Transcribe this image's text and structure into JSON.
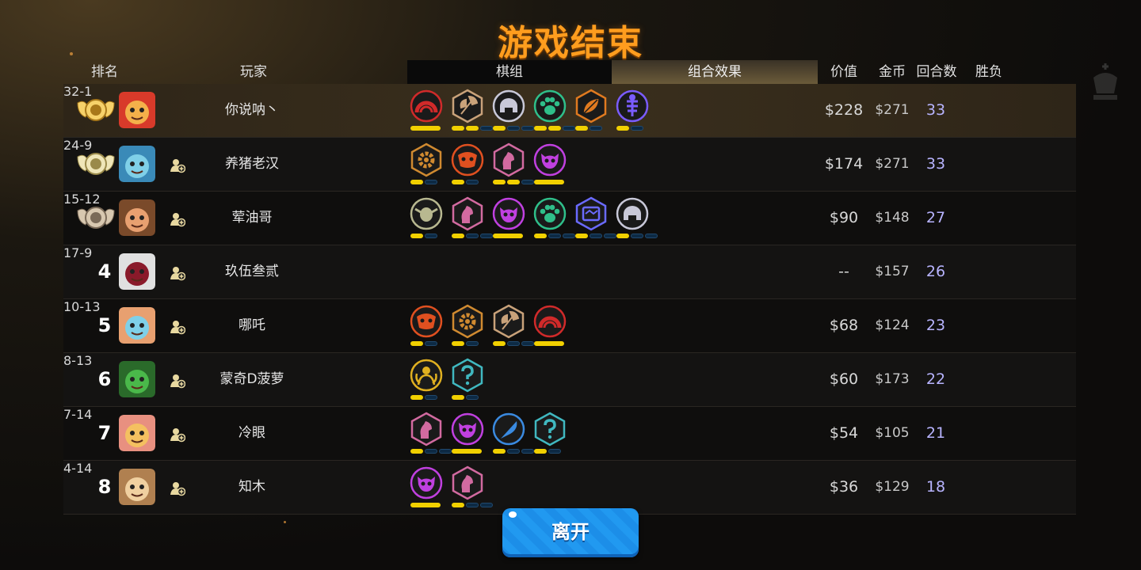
{
  "title": "游戏结束",
  "headers": {
    "rank": "排名",
    "player": "玩家",
    "pieces": "棋组",
    "combo": "组合效果",
    "value": "价值",
    "gold": "金币",
    "rounds": "回合数",
    "winloss": "胜负"
  },
  "leave_button": "离开",
  "colors": {
    "title": "#ff9d1e",
    "bar_on": "#f1d000",
    "bar_off": "#0d2a44",
    "rounds": "#b8b4ff",
    "button": "#1c8ee8"
  },
  "players": [
    {
      "rank": "1",
      "medal": "gold-medal",
      "name": "你说呐丶",
      "value": "$228",
      "gold": "$271",
      "rounds": "33",
      "winloss": "32-1",
      "traits": [
        {
          "icon": "red-arch-icon",
          "color": "#d02a2a",
          "shape": "circle",
          "bars": [
            2
          ]
        },
        {
          "icon": "axe-icon",
          "color": "#c9a27a",
          "shape": "hex",
          "bars": [
            1,
            1,
            0
          ]
        },
        {
          "icon": "helmet-icon",
          "color": "#c8c8d8",
          "shape": "circle",
          "bars": [
            1,
            0,
            0
          ]
        },
        {
          "icon": "paw-icon",
          "color": "#2fbf8a",
          "shape": "circle",
          "bars": [
            1,
            1,
            0
          ]
        },
        {
          "icon": "leaf-icon",
          "color": "#e07a20",
          "shape": "hex",
          "bars": [
            1,
            0
          ]
        },
        {
          "icon": "fishbone-icon",
          "color": "#7a5cff",
          "shape": "circle",
          "bars": [
            1,
            0
          ]
        }
      ]
    },
    {
      "rank": "2",
      "medal": "silver-medal",
      "name": "养猪老汉",
      "value": "$174",
      "gold": "$271",
      "rounds": "33",
      "winloss": "24-9",
      "traits": [
        {
          "icon": "gear-icon",
          "color": "#d08a30",
          "shape": "hex",
          "bars": [
            1,
            0
          ]
        },
        {
          "icon": "demon-mask-icon",
          "color": "#e05020",
          "shape": "circle",
          "bars": [
            1,
            0
          ]
        },
        {
          "icon": "knight-icon",
          "color": "#d26aa0",
          "shape": "hex",
          "bars": [
            1,
            1,
            0
          ]
        },
        {
          "icon": "imp-icon",
          "color": "#c040e0",
          "shape": "circle",
          "bars": [
            2
          ]
        }
      ]
    },
    {
      "rank": "3",
      "medal": "bronze-medal",
      "name": "荤油哥",
      "value": "$90",
      "gold": "$148",
      "rounds": "27",
      "winloss": "15-12",
      "traits": [
        {
          "icon": "goblin-icon",
          "color": "#b8b890",
          "shape": "circle",
          "bars": [
            1,
            0
          ]
        },
        {
          "icon": "knight-icon",
          "color": "#d26aa0",
          "shape": "hex",
          "bars": [
            1,
            0,
            0
          ]
        },
        {
          "icon": "imp-icon",
          "color": "#c040e0",
          "shape": "circle",
          "bars": [
            2
          ]
        },
        {
          "icon": "paw-icon",
          "color": "#2fbf8a",
          "shape": "circle",
          "bars": [
            1,
            0,
            0
          ]
        },
        {
          "icon": "robot-icon",
          "color": "#6a6aff",
          "shape": "hex",
          "bars": [
            1,
            0,
            0
          ]
        },
        {
          "icon": "helmet-icon",
          "color": "#c8c8d8",
          "shape": "circle",
          "bars": [
            1,
            0,
            0
          ]
        }
      ]
    },
    {
      "rank": "4",
      "medal": "",
      "name": "玖伍叁贰",
      "value": "--",
      "gold": "$157",
      "rounds": "26",
      "winloss": "17-9",
      "traits": []
    },
    {
      "rank": "5",
      "medal": "",
      "name": "哪吒",
      "value": "$68",
      "gold": "$124",
      "rounds": "23",
      "winloss": "10-13",
      "traits": [
        {
          "icon": "demon-mask-icon",
          "color": "#e05020",
          "shape": "circle",
          "bars": [
            1,
            0
          ]
        },
        {
          "icon": "gear-icon",
          "color": "#d08a30",
          "shape": "hex",
          "bars": [
            1,
            0
          ]
        },
        {
          "icon": "axe-icon",
          "color": "#c9a27a",
          "shape": "hex",
          "bars": [
            1,
            0,
            0
          ]
        },
        {
          "icon": "red-arch-icon",
          "color": "#d02a2a",
          "shape": "circle",
          "bars": [
            2
          ]
        }
      ]
    },
    {
      "rank": "6",
      "medal": "",
      "name": "蒙奇D菠萝",
      "value": "$60",
      "gold": "$173",
      "rounds": "22",
      "winloss": "8-13",
      "traits": [
        {
          "icon": "goddess-icon",
          "color": "#e0b020",
          "shape": "circle",
          "bars": [
            1,
            0
          ]
        },
        {
          "icon": "mystery-icon",
          "color": "#40b8c0",
          "shape": "hex",
          "bars": [
            1,
            0
          ]
        }
      ]
    },
    {
      "rank": "7",
      "medal": "",
      "name": "冷眼",
      "value": "$54",
      "gold": "$105",
      "rounds": "21",
      "winloss": "7-14",
      "traits": [
        {
          "icon": "knight-icon",
          "color": "#d26aa0",
          "shape": "hex",
          "bars": [
            1,
            0,
            0
          ]
        },
        {
          "icon": "imp-icon",
          "color": "#c040e0",
          "shape": "circle",
          "bars": [
            2
          ]
        },
        {
          "icon": "feather-icon",
          "color": "#3a8ae0",
          "shape": "circle",
          "bars": [
            1,
            0,
            0
          ]
        },
        {
          "icon": "mystery-icon",
          "color": "#40b8c0",
          "shape": "hex",
          "bars": [
            1,
            0
          ]
        }
      ]
    },
    {
      "rank": "8",
      "medal": "",
      "name": "知木",
      "value": "$36",
      "gold": "$129",
      "rounds": "18",
      "winloss": "4-14",
      "traits": [
        {
          "icon": "imp-icon",
          "color": "#c040e0",
          "shape": "circle",
          "bars": [
            2
          ]
        },
        {
          "icon": "knight-icon",
          "color": "#d26aa0",
          "shape": "hex",
          "bars": [
            1,
            0,
            0
          ]
        }
      ]
    }
  ]
}
